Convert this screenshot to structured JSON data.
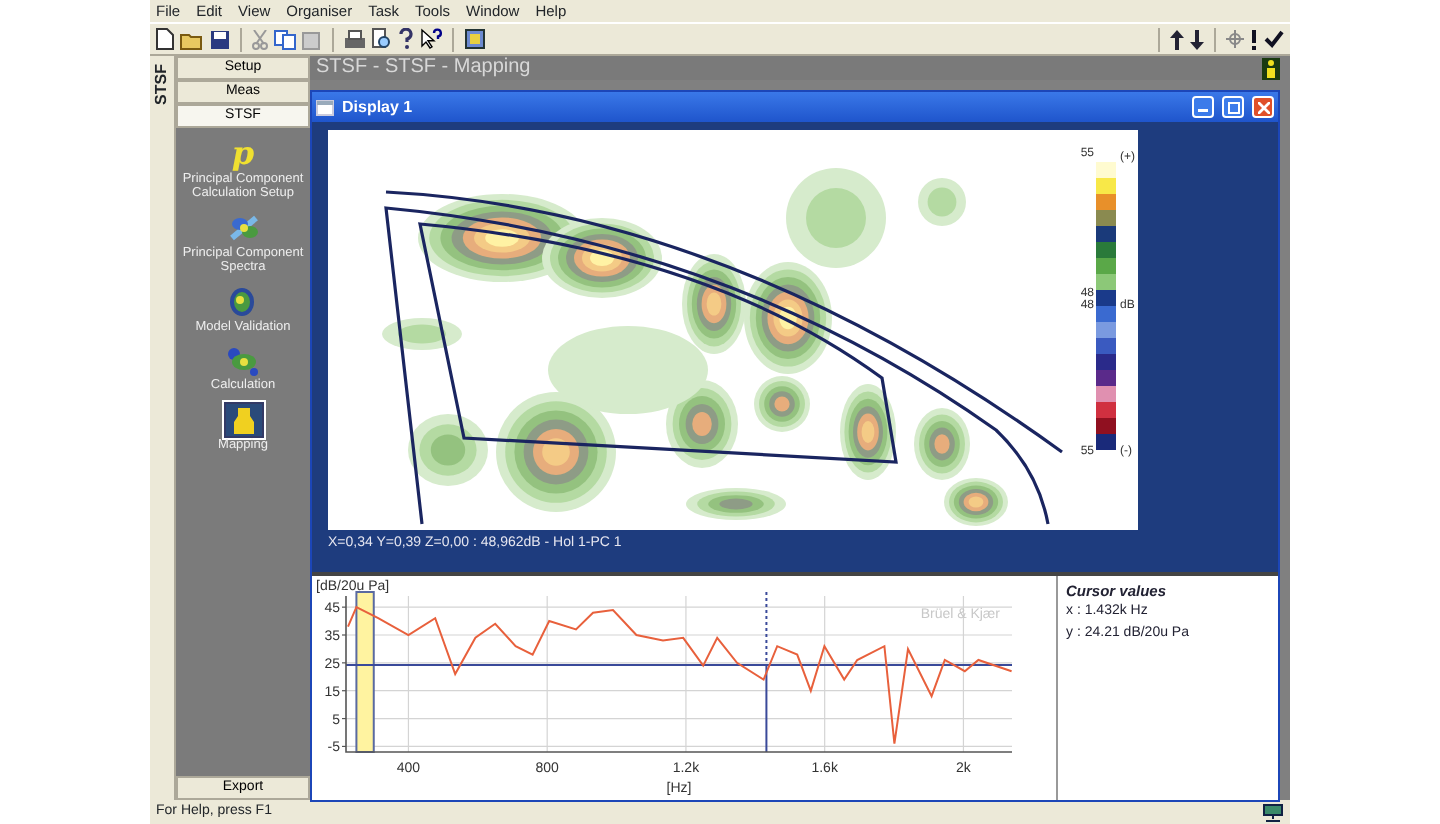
{
  "menu_bar": {
    "items": [
      "File",
      "Edit",
      "View",
      "Organiser",
      "Task",
      "Tools",
      "Window",
      "Help"
    ]
  },
  "side_tab": {
    "label": "STSF"
  },
  "sidebar": {
    "tabs": [
      {
        "label": "Setup",
        "selected": false
      },
      {
        "label": "Meas",
        "selected": false
      },
      {
        "label": "STSF",
        "selected": true
      }
    ],
    "items": [
      {
        "kind": "glyph",
        "glyph": "p",
        "label": "Principal Component Calculation Setup",
        "selected": false
      },
      {
        "kind": "spectra",
        "label": "Principal Component Spectra",
        "selected": false
      },
      {
        "kind": "validation",
        "label": "Model Validation",
        "selected": false
      },
      {
        "kind": "calculation",
        "label": "Calculation",
        "selected": false
      },
      {
        "kind": "mapping",
        "label": "Mapping",
        "selected": true
      }
    ],
    "export_button": "Export"
  },
  "main_title": "STSF - STSF - Mapping",
  "display_window": {
    "title": "Display 1",
    "colorbar": {
      "top_value": "55",
      "top_sign": "(+)",
      "mid_values": [
        "48",
        "48"
      ],
      "unit": "dB",
      "bottom_value": "55",
      "bottom_sign": "(-)"
    },
    "status": "X=0,34 Y=0,39 Z=0,00 : 48,962dB - Hol 1-PC 1"
  },
  "spectrum_panel": {
    "brand_text": "Brüel & Kjær",
    "chart_data": {
      "type": "line",
      "xlabel": "[Hz]",
      "ylabel": "[dB/20u Pa]",
      "x": [
        226,
        250,
        313,
        400,
        477,
        535,
        593,
        650,
        709,
        758,
        806,
        883,
        932,
        990,
        1057,
        1134,
        1192,
        1250,
        1290,
        1347,
        1424,
        1463,
        1521,
        1560,
        1599,
        1656,
        1694,
        1772,
        1801,
        1840,
        1908,
        1946,
        2004,
        2043,
        2139
      ],
      "series": [
        {
          "color": "#e8603c",
          "values": [
            38,
            45,
            41,
            35,
            41,
            21,
            34,
            39,
            31,
            28,
            40,
            37,
            43,
            44,
            35,
            33,
            34,
            24,
            34,
            25,
            19,
            31,
            28,
            15,
            31,
            19,
            26,
            31,
            -4,
            30,
            13,
            26,
            22,
            26,
            22
          ]
        }
      ],
      "xlim": [
        220,
        2140
      ],
      "ylim": [
        -7,
        49
      ],
      "xticks": [
        400,
        800,
        {
          "value": 1200,
          "label": "1.2k"
        },
        {
          "value": 1600,
          "label": "1.6k"
        },
        {
          "value": 2000,
          "label": "2k"
        }
      ],
      "yticks": [
        -5,
        5,
        15,
        25,
        35,
        45
      ],
      "grid": true,
      "bands": [
        {
          "axis": "x",
          "from": 250,
          "to": 300
        }
      ],
      "ref_lines": [
        {
          "axis": "x",
          "value": 1432
        },
        {
          "axis": "y",
          "value": 24.21
        }
      ]
    }
  },
  "cursor_values": {
    "title": "Cursor values",
    "x": "x : 1.432k Hz",
    "y": "y : 24.21 dB/20u Pa"
  },
  "status_bar": {
    "text": "For Help, press F1"
  }
}
